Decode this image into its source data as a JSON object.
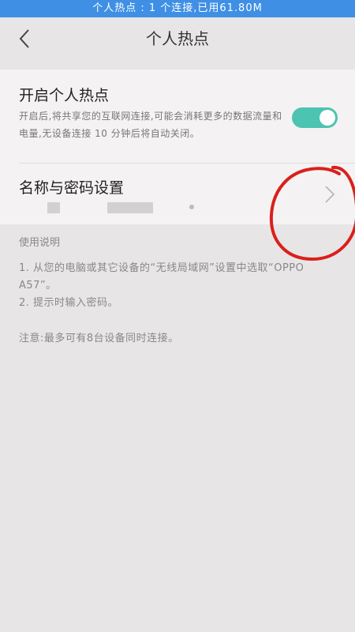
{
  "status_bar": {
    "text": "个人热点 : 1 个连接,已用61.80M"
  },
  "header": {
    "title": "个人热点"
  },
  "hotspot": {
    "title": "开启个人热点",
    "description": "开启后,将共享您的互联网连接,可能会消耗更多的数据流量和电量,无设备连接 10 分钟后将自动关闭。",
    "enabled": true,
    "toggle_color": "#4dc3b2"
  },
  "name_password": {
    "label": "名称与密码设置"
  },
  "help": {
    "title": "使用说明",
    "lines": [
      "1. 从您的电脑或其它设备的“无线局域网”设置中选取“OPPO A57”。",
      "2. 提示时输入密码。"
    ],
    "note": "注意:最多可有8台设备同时连接。"
  },
  "colors": {
    "status_bar": "#3f8fe4",
    "background": "#e8e5e6",
    "annotation": "#d9201c"
  }
}
